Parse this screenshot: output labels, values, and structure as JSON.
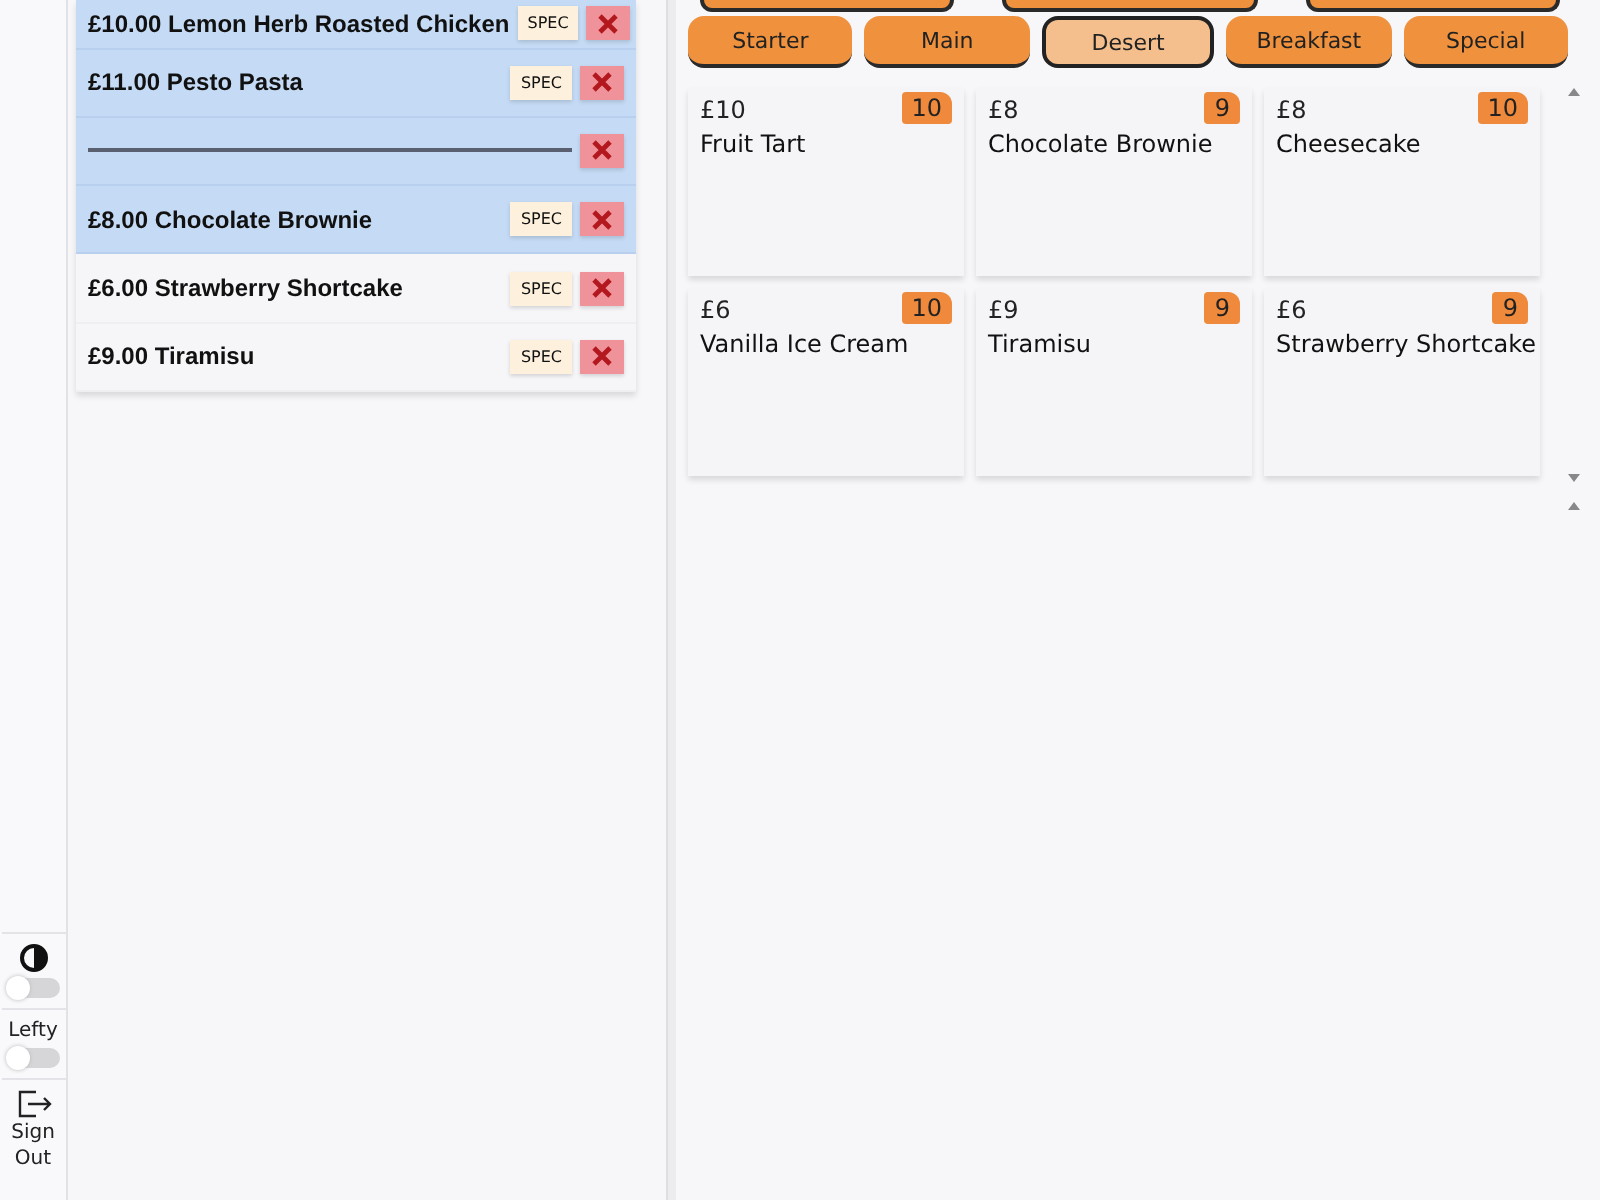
{
  "sidebar": {
    "theme_toggle": {
      "on": false
    },
    "lefty": {
      "label": "Lefty",
      "on": false
    },
    "sign_out": {
      "label": "Sign Out"
    }
  },
  "order": {
    "items": [
      {
        "kind": "item",
        "text": "£10.00 Lemon Herb Roasted Chicken",
        "selected": true,
        "spec": "SPEC"
      },
      {
        "kind": "item",
        "text": "£11.00 Pesto Pasta",
        "selected": true,
        "spec": "SPEC"
      },
      {
        "kind": "separator",
        "selected": true
      },
      {
        "kind": "item",
        "text": "£8.00 Chocolate Brownie",
        "selected": true,
        "spec": "SPEC"
      },
      {
        "kind": "item",
        "text": "£6.00 Strawberry Shortcake",
        "selected": false,
        "spec": "SPEC"
      },
      {
        "kind": "item",
        "text": "£9.00 Tiramisu",
        "selected": false,
        "spec": "SPEC"
      }
    ]
  },
  "categories": [
    {
      "label": "Starter",
      "selected": false
    },
    {
      "label": "Main",
      "selected": false
    },
    {
      "label": "Desert",
      "selected": true
    },
    {
      "label": "Breakfast",
      "selected": false
    },
    {
      "label": "Special",
      "selected": false
    }
  ],
  "menu_items": [
    {
      "price": "£10",
      "name": "Fruit Tart",
      "count": "10"
    },
    {
      "price": "£8",
      "name": "Chocolate Brownie",
      "count": "9"
    },
    {
      "price": "£8",
      "name": "Cheesecake",
      "count": "10"
    },
    {
      "price": "£6",
      "name": "Vanilla Ice Cream",
      "count": "10"
    },
    {
      "price": "£9",
      "name": "Tiramisu",
      "count": "9"
    },
    {
      "price": "£6",
      "name": "Strawberry Shortcake",
      "count": "9"
    }
  ]
}
